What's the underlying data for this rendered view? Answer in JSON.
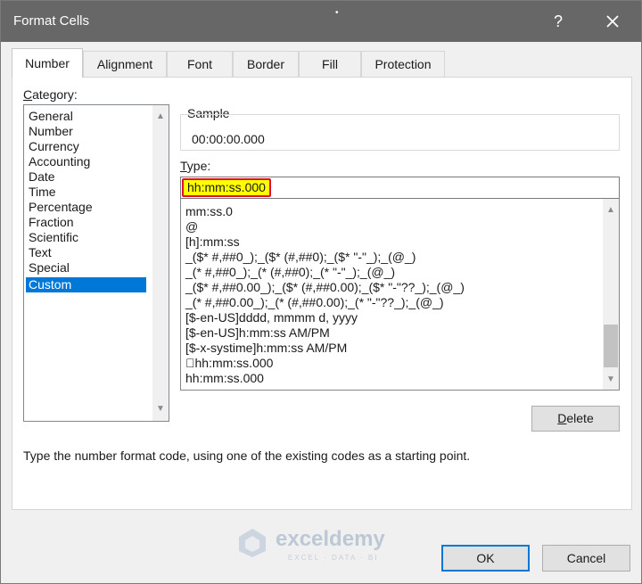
{
  "window": {
    "title": "Format Cells",
    "help_label": "?",
    "close_icon": "close-icon"
  },
  "tabs": [
    {
      "label": "Number",
      "active": true
    },
    {
      "label": "Alignment"
    },
    {
      "label": "Font"
    },
    {
      "label": "Border"
    },
    {
      "label": "Fill"
    },
    {
      "label": "Protection"
    }
  ],
  "category": {
    "label": "Category:",
    "items": [
      "General",
      "Number",
      "Currency",
      "Accounting",
      "Date",
      "Time",
      "Percentage",
      "Fraction",
      "Scientific",
      "Text",
      "Special",
      "Custom"
    ],
    "selected": "Custom"
  },
  "sample": {
    "label": "Sample",
    "value": "00:00:00.000"
  },
  "type": {
    "label": "Type:",
    "value": "hh:mm:ss.000",
    "highlight_color": "#ffff00",
    "outline_color": "#e0102a",
    "formats": [
      "mm:ss.0",
      "@",
      "[h]:mm:ss",
      "_($* #,##0_);_($* (#,##0);_($* \"-\"_);_(@_)",
      "_(* #,##0_);_(* (#,##0);_(* \"-\"_);_(@_)",
      "_($* #,##0.00_);_($* (#,##0.00);_($* \"-\"??_);_(@_)",
      "_(* #,##0.00_);_(* (#,##0.00);_(* \"-\"??_);_(@_)",
      "[$-en-US]dddd, mmmm d, yyyy",
      "[$-en-US]h:mm:ss AM/PM",
      "[$-x-systime]h:mm:ss AM/PM",
      "\u0000hh:mm:ss.000",
      "hh:mm:ss.000"
    ]
  },
  "buttons": {
    "delete": "Delete",
    "ok": "OK",
    "cancel": "Cancel"
  },
  "hint": "Type the number format code, using one of the existing codes as a starting point.",
  "watermark": {
    "name": "exceldemy",
    "tagline": "EXCEL · DATA · BI"
  },
  "colors": {
    "titlebar": "#676767",
    "selection": "#0078d7"
  }
}
